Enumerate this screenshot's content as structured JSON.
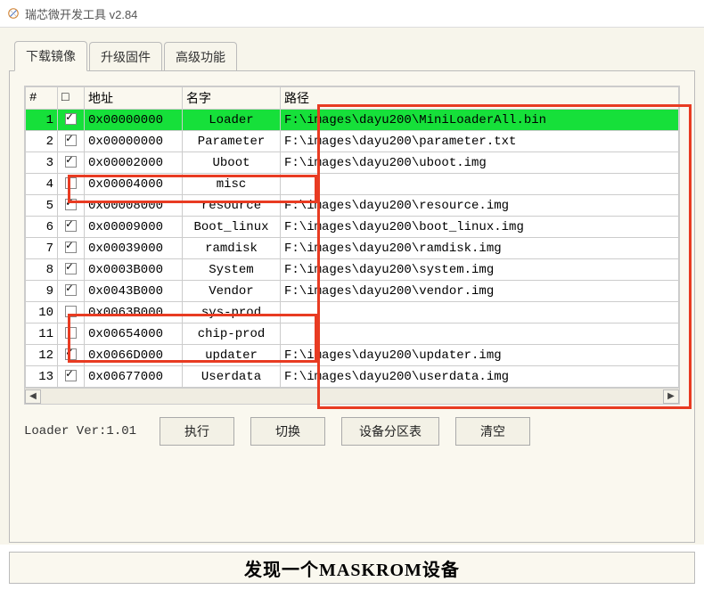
{
  "title": "瑞芯微开发工具 v2.84",
  "tabs": [
    {
      "label": "下载镜像",
      "active": true
    },
    {
      "label": "升级固件",
      "active": false
    },
    {
      "label": "高级功能",
      "active": false
    }
  ],
  "columns": {
    "index": "#",
    "check": "□",
    "address": "地址",
    "name": "名字",
    "path": "路径"
  },
  "rows": [
    {
      "idx": "1",
      "checked": true,
      "address": "0x00000000",
      "name": "Loader",
      "path": "F:\\images\\dayu200\\MiniLoaderAll.bin",
      "highlight": true
    },
    {
      "idx": "2",
      "checked": true,
      "address": "0x00000000",
      "name": "Parameter",
      "path": "F:\\images\\dayu200\\parameter.txt"
    },
    {
      "idx": "3",
      "checked": true,
      "address": "0x00002000",
      "name": "Uboot",
      "path": "F:\\images\\dayu200\\uboot.img"
    },
    {
      "idx": "4",
      "checked": false,
      "address": "0x00004000",
      "name": "misc",
      "path": ""
    },
    {
      "idx": "5",
      "checked": true,
      "address": "0x00008000",
      "name": "resource",
      "path": "F:\\images\\dayu200\\resource.img"
    },
    {
      "idx": "6",
      "checked": true,
      "address": "0x00009000",
      "name": "Boot_linux",
      "path": "F:\\images\\dayu200\\boot_linux.img"
    },
    {
      "idx": "7",
      "checked": true,
      "address": "0x00039000",
      "name": "ramdisk",
      "path": "F:\\images\\dayu200\\ramdisk.img"
    },
    {
      "idx": "8",
      "checked": true,
      "address": "0x0003B000",
      "name": "System",
      "path": "F:\\images\\dayu200\\system.img"
    },
    {
      "idx": "9",
      "checked": true,
      "address": "0x0043B000",
      "name": "Vendor",
      "path": "F:\\images\\dayu200\\vendor.img"
    },
    {
      "idx": "10",
      "checked": false,
      "address": "0x0063B000",
      "name": "sys-prod",
      "path": ""
    },
    {
      "idx": "11",
      "checked": false,
      "address": "0x00654000",
      "name": "chip-prod",
      "path": ""
    },
    {
      "idx": "12",
      "checked": true,
      "address": "0x0066D000",
      "name": "updater",
      "path": "F:\\images\\dayu200\\updater.img"
    },
    {
      "idx": "13",
      "checked": true,
      "address": "0x00677000",
      "name": "Userdata",
      "path": "F:\\images\\dayu200\\userdata.img"
    }
  ],
  "loader_ver": "Loader Ver:1.01",
  "buttons": {
    "run": "执行",
    "switch": "切换",
    "partition": "设备分区表",
    "clear": "清空"
  },
  "status": "发现一个MASKROM设备",
  "highlight_color": "#16e03a",
  "annotation_color": "#e83b22"
}
